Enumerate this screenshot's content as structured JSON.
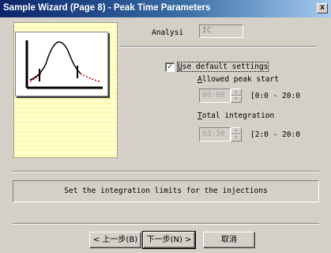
{
  "window": {
    "title": "Sample Wizard (Page 8) - Peak Time Parameters",
    "close_label": "x"
  },
  "analysis": {
    "label": "Analysi",
    "value": "IC"
  },
  "default_settings": {
    "checked": true,
    "check_mark": "✓",
    "label_prefix": "U",
    "label_rest": "se default settings"
  },
  "peak_start": {
    "label_prefix": "A",
    "label_rest": "llowed peak start",
    "value": "00:00",
    "range": "[0:0 - 20:0"
  },
  "total_integration": {
    "label_prefix": "T",
    "label_rest": "otal integration",
    "value": "03:30",
    "range": "[2:0 - 20:0"
  },
  "status": {
    "message": "Set the integration limits for the injections"
  },
  "buttons": {
    "back": "< 上一步(B)",
    "next": "下一步(N) >",
    "cancel": "取消"
  },
  "colors": {
    "title_start": "#0a246a",
    "title_end": "#a6caf0",
    "panel_bg": "#ffffc8",
    "curve_dashed": "#cc0000"
  }
}
